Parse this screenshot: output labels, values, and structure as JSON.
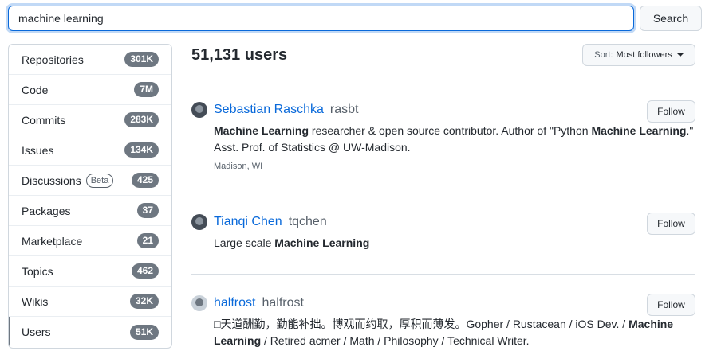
{
  "search": {
    "query": "machine learning",
    "button_label": "Search"
  },
  "sidebar": {
    "items": [
      {
        "label": "Repositories",
        "count": "301K"
      },
      {
        "label": "Code",
        "count": "7M"
      },
      {
        "label": "Commits",
        "count": "283K"
      },
      {
        "label": "Issues",
        "count": "134K"
      },
      {
        "label": "Discussions",
        "badge": "Beta",
        "count": "425"
      },
      {
        "label": "Packages",
        "count": "37"
      },
      {
        "label": "Marketplace",
        "count": "21"
      },
      {
        "label": "Topics",
        "count": "462"
      },
      {
        "label": "Wikis",
        "count": "32K"
      },
      {
        "label": "Users",
        "count": "51K",
        "selected": true
      }
    ]
  },
  "results": {
    "count_label": "51,131 users",
    "sort_prefix": "Sort:",
    "sort_value": "Most followers"
  },
  "users": [
    {
      "name": "Sebastian Raschka",
      "login": "rasbt",
      "bio_html": "<b>Machine Learning</b> researcher &amp; open source contributor. Author of \"Python <b>Machine Learning</b>.\" Asst. Prof. of Statistics @ UW-Madison.",
      "location": "Madison, WI",
      "follow_label": "Follow"
    },
    {
      "name": "Tianqi Chen",
      "login": "tqchen",
      "bio_html": "Large scale <b>Machine Learning</b>",
      "location": "",
      "follow_label": "Follow"
    },
    {
      "name": "halfrost",
      "login": "halfrost",
      "bio_html": "□天道酬勤，勤能补拙。博观而约取，厚积而薄发。Gopher / Rustacean / iOS Dev. / <b>Machine Learning</b> / Retired acmer / Math / Philosophy / Technical Writer.",
      "location": "",
      "follow_label": "Follow"
    }
  ],
  "colors": {
    "accent": "#0969da",
    "counter_bg": "#6e7781",
    "border": "#d0d7de"
  }
}
